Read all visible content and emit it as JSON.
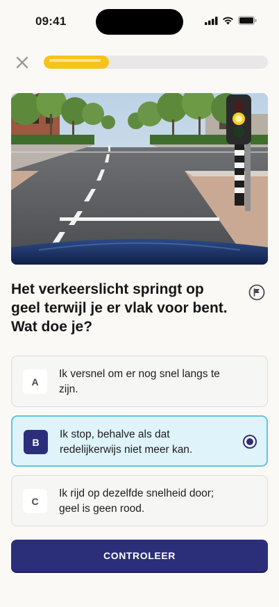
{
  "status_bar": {
    "time": "09:41"
  },
  "quiz": {
    "progress": 0.29,
    "question": "Het verkeerslicht springt op geel terwijl je er vlak voor bent. Wat doe je?",
    "options": [
      {
        "letter": "A",
        "text": "Ik versnel om er nog snel langs te zijn.",
        "selected": false
      },
      {
        "letter": "B",
        "text": "Ik stop, behalve als dat redelijkerwijs niet meer kan.",
        "selected": true
      },
      {
        "letter": "C",
        "text": "Ik rijd op dezelfde snelheid door; geel is geen rood.",
        "selected": false
      }
    ],
    "check_label": "CONTROLEER"
  },
  "colors": {
    "accent": "#2b2f7a",
    "progress": "#f7c31a",
    "selected_bg": "#dff3fb",
    "selected_border": "#63c3e6"
  },
  "icons": {
    "close": "close-icon",
    "flag": "flag-icon",
    "signal": "cellular-signal-icon",
    "wifi": "wifi-icon",
    "battery": "battery-icon"
  }
}
